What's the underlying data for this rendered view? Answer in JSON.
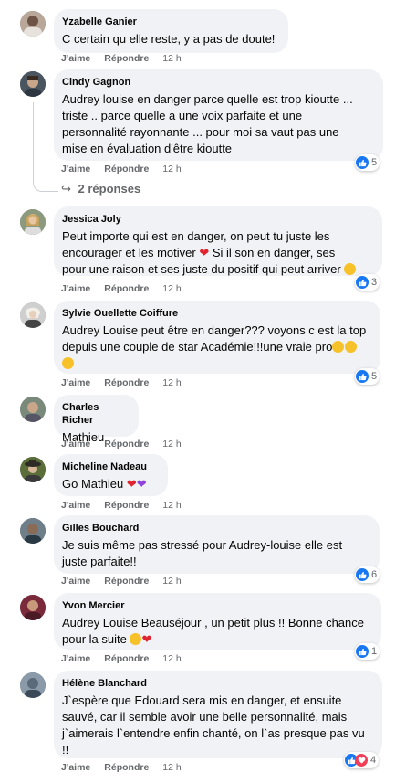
{
  "labels": {
    "like": "J'aime",
    "reply": "Répondre",
    "time": "12 h"
  },
  "replies_label": "2 réponses",
  "comments": [
    {
      "author": "Yzabelle Ganier",
      "text": "C certain qu elle reste, y a pas de doute!",
      "reactions": ""
    },
    {
      "author": "Cindy Gagnon",
      "text": "Audrey louise en danger parce quelle est trop kioutte ...\ntriste .. parce quelle a une voix parfaite et une\npersonnalité rayonnante ... pour moi sa vaut pas une\nmise en évaluation d'être kioutte",
      "reactions": "5"
    },
    {
      "author": "Jessica Joly",
      "text": "Peut importe qui est en danger, on peut tu juste les\nencourager et les motiver",
      "text2": " Si il son en danger, ses\npour une raison et ses juste du positif qui peut arriver",
      "reactions": "3"
    },
    {
      "author": "Sylvie Ouellette Coiffure",
      "text": "Audrey Louise peut être en danger??? voyons c est la top\ndepuis une couple de star Académie!!!une vraie pro",
      "reactions": "5"
    },
    {
      "author": "Charles Richer",
      "text": "Mathieu",
      "reactions": ""
    },
    {
      "author": "Micheline Nadeau",
      "text": "Go Mathieu ",
      "reactions": ""
    },
    {
      "author": "Gilles Bouchard",
      "text": "Je suis même pas stressé pour Audrey-louise elle est\njuste parfaite!!",
      "reactions": "6"
    },
    {
      "author": "Yvon Mercier",
      "text": "Audrey Louise Beauséjour , un petit plus !! Bonne chance\npour la suite ",
      "reactions": "1"
    },
    {
      "author": "Hélène Blanchard",
      "text": "J`espère que Edouard sera mis en danger, et ensuite\nsauvé, car il semble avoir une belle personnalité, mais\nj`aimerais l`entendre enfin chanté, on l`as presque pas vu\n!!",
      "reactions": "4"
    }
  ],
  "colors": {
    "like": "#1877f2",
    "love": "#f33e58",
    "bubble": "#f0f2f5"
  }
}
